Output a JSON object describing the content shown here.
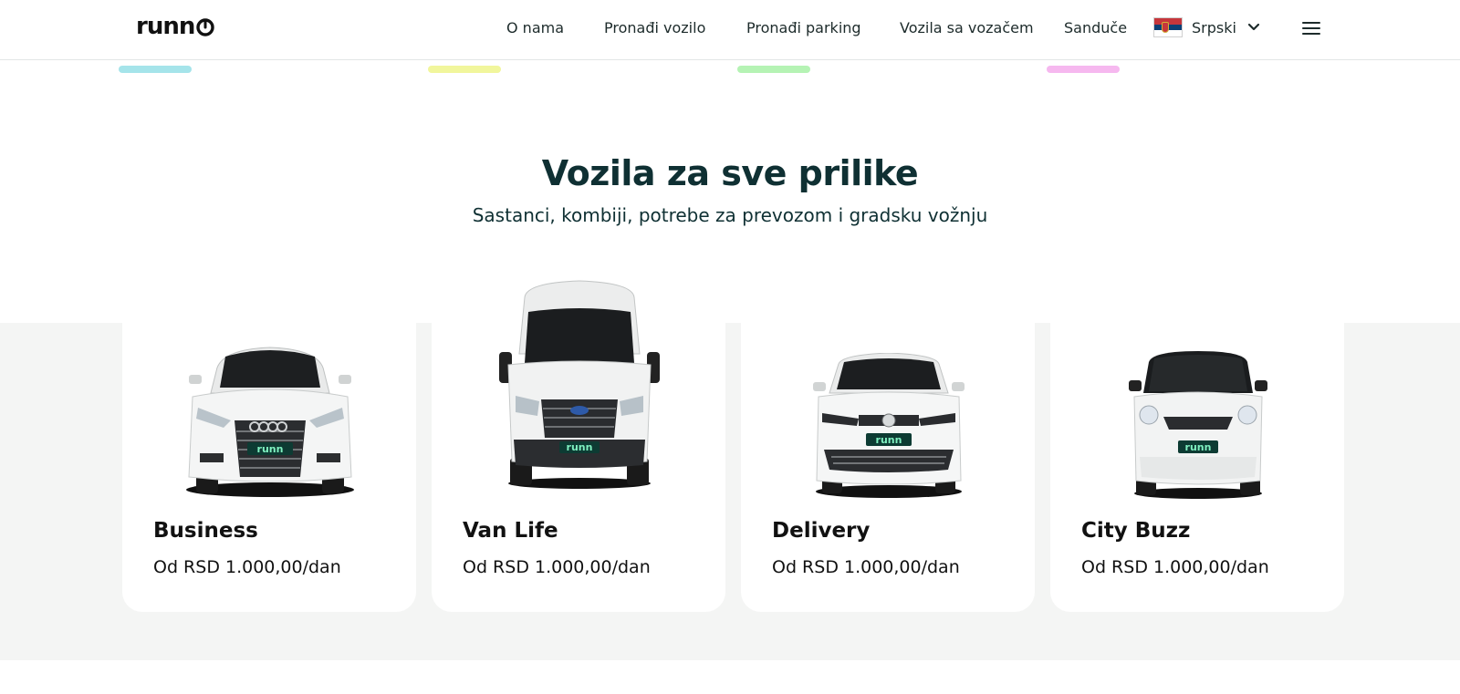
{
  "header": {
    "logo": "runn",
    "nav": [
      "O nama",
      "Pronađi vozilo",
      "Pronađi parking",
      "Vozila sa vozačem",
      "Sanduče"
    ],
    "language": "Srpski",
    "icons": [
      "chevron-down-icon",
      "hamburger-menu-icon"
    ]
  },
  "accent_bars": [
    "#a5e4ea",
    "#f1f69c",
    "#b5f3b4",
    "#f6b8ef"
  ],
  "hero": {
    "title": "Vozila za sve prilike",
    "subtitle": "Sastanci, kombiji, potrebe za prevozom i gradsku vožnju",
    "highlight_color": "#f4b8ef"
  },
  "cards": [
    {
      "name": "Business",
      "price": "Od RSD 1.000,00/dan",
      "plate": "runn"
    },
    {
      "name": "Van Life",
      "price": "Od RSD 1.000,00/dan",
      "plate": "runn"
    },
    {
      "name": "Delivery",
      "price": "Od RSD 1.000,00/dan",
      "plate": "runn"
    },
    {
      "name": "City Buzz",
      "price": "Od RSD 1.000,00/dan",
      "plate": "runn"
    }
  ]
}
